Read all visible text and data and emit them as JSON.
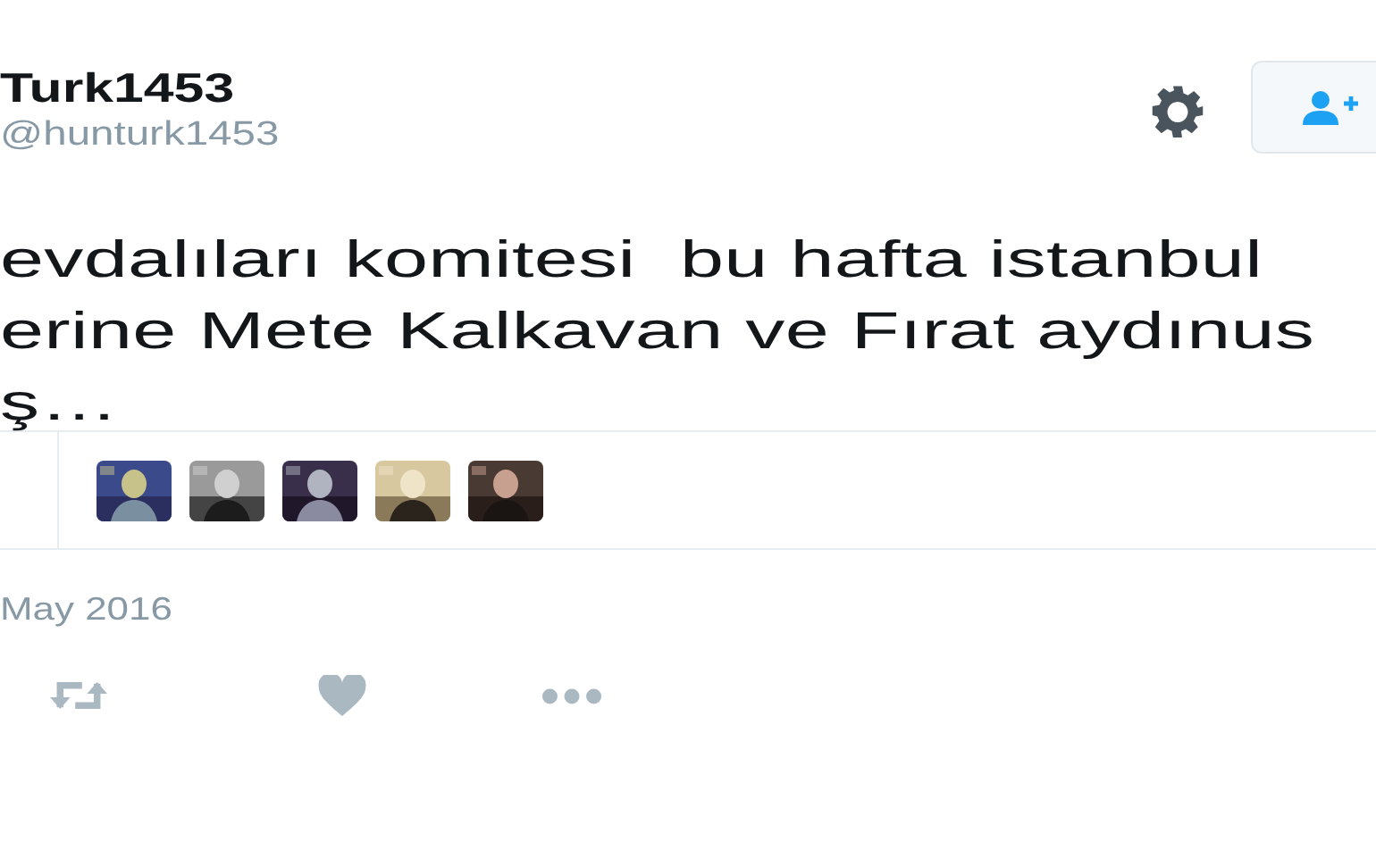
{
  "user": {
    "name": "Turk1453",
    "handle": "@hunturk1453"
  },
  "tweet_lines": [
    "evdalıları komitesi  bu hafta istanbul",
    "erine Mete Kalkavan ve Fırat aydınus",
    "ş…"
  ],
  "date": "May 2016"
}
